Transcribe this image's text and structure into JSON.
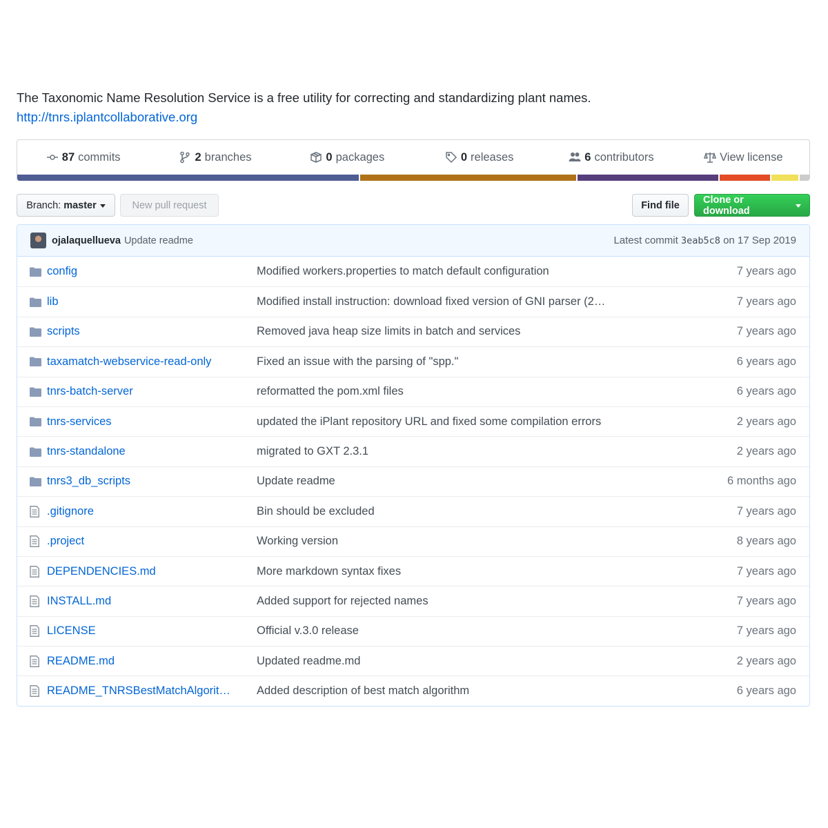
{
  "about": {
    "description": "The Taxonomic Name Resolution Service is a free utility for correcting and standardizing plant names.",
    "homepage": "http://tnrs.iplantcollaborative.org"
  },
  "summary": {
    "commits": {
      "count": "87",
      "label": "commits",
      "icon": "commit-icon"
    },
    "branches": {
      "count": "2",
      "label": "branches",
      "icon": "branch-icon"
    },
    "packages": {
      "count": "0",
      "label": "packages",
      "icon": "package-icon"
    },
    "releases": {
      "count": "0",
      "label": "releases",
      "icon": "tag-icon"
    },
    "contributors": {
      "count": "6",
      "label": "contributors",
      "icon": "people-icon"
    },
    "license": {
      "label": "View license",
      "icon": "law-icon"
    }
  },
  "languages": [
    {
      "color": "#4F5D95",
      "percent": 43.3
    },
    {
      "color": "#B07219",
      "percent": 27.4
    },
    {
      "color": "#563D7C",
      "percent": 18.0
    },
    {
      "color": "#E34C26",
      "percent": 6.5
    },
    {
      "color": "#F1E05A",
      "percent": 3.6
    },
    {
      "color": "#CCCCCC",
      "percent": 1.2
    }
  ],
  "toolbar": {
    "branch_prefix": "Branch:",
    "branch_name": "master",
    "new_pull_request": "New pull request",
    "find_file": "Find file",
    "clone_or_download": "Clone or download"
  },
  "latest_commit": {
    "author": "ojalaquellueva",
    "message": "Update readme",
    "prefix": "Latest commit",
    "sha": "3eab5c8",
    "date": "on 17 Sep 2019"
  },
  "files": [
    {
      "type": "dir",
      "name": "config",
      "message": "Modified workers.properties to match default configuration",
      "age": "7 years ago"
    },
    {
      "type": "dir",
      "name": "lib",
      "message": "Modified install instruction: download fixed version of GNI parser (2…",
      "age": "7 years ago"
    },
    {
      "type": "dir",
      "name": "scripts",
      "message": "Removed java heap size limits in batch and services",
      "age": "7 years ago"
    },
    {
      "type": "dir",
      "name": "taxamatch-webservice-read-only",
      "message": "Fixed an issue with the parsing of \"spp.\"",
      "age": "6 years ago"
    },
    {
      "type": "dir",
      "name": "tnrs-batch-server",
      "message": "reformatted the pom.xml files",
      "age": "6 years ago"
    },
    {
      "type": "dir",
      "name": "tnrs-services",
      "message": "updated the iPlant repository URL and fixed some compilation errors",
      "age": "2 years ago"
    },
    {
      "type": "dir",
      "name": "tnrs-standalone",
      "message": "migrated to GXT 2.3.1",
      "age": "2 years ago"
    },
    {
      "type": "dir",
      "name": "tnrs3_db_scripts",
      "message": "Update readme",
      "age": "6 months ago"
    },
    {
      "type": "file",
      "name": ".gitignore",
      "message": "Bin should be excluded",
      "age": "7 years ago"
    },
    {
      "type": "file",
      "name": ".project",
      "message": "Working version",
      "age": "8 years ago"
    },
    {
      "type": "file",
      "name": "DEPENDENCIES.md",
      "message": "More markdown syntax fixes",
      "age": "7 years ago"
    },
    {
      "type": "file",
      "name": "INSTALL.md",
      "message": "Added support for rejected names",
      "age": "7 years ago"
    },
    {
      "type": "file",
      "name": "LICENSE",
      "message": "Official v.3.0 release",
      "age": "7 years ago"
    },
    {
      "type": "file",
      "name": "README.md",
      "message": "Updated readme.md",
      "age": "2 years ago"
    },
    {
      "type": "file",
      "name": "README_TNRSBestMatchAlgorit…",
      "message": "Added description of best match algorithm",
      "age": "6 years ago"
    }
  ]
}
